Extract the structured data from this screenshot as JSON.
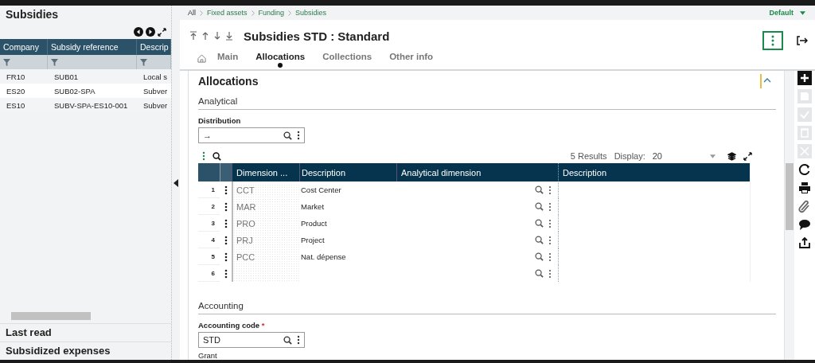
{
  "top_bar": {
    "breadcrumb": [
      "All",
      "Fixed assets",
      "Funding",
      "Subsidies"
    ],
    "profile": "Default"
  },
  "left_panel": {
    "title": "Subsidies",
    "table": {
      "columns": [
        "Company",
        "Subsidy reference",
        "Descrip"
      ],
      "rows": [
        [
          "FR10",
          "SUB01",
          "Local s"
        ],
        [
          "ES20",
          "SUB02-SPA",
          "Subver"
        ],
        [
          "ES10",
          "SUBV-SPA-ES10-001",
          "Subver"
        ]
      ]
    },
    "sections": [
      "Last read",
      "Subsidized expenses"
    ]
  },
  "record": {
    "title": "Subsidies STD : Standard"
  },
  "tabs": [
    {
      "label": "Main",
      "selected": false
    },
    {
      "label": "Allocations",
      "selected": true
    },
    {
      "label": "Collections",
      "selected": false
    },
    {
      "label": "Other info",
      "selected": false
    }
  ],
  "allocations": {
    "title": "Allocations",
    "analytical": {
      "title": "Analytical",
      "distribution": {
        "label": "Distribution",
        "value": "→"
      },
      "grid": {
        "results": "5 Results",
        "display_label": "Display:",
        "display_value": "20",
        "columns": [
          "Dimension ...",
          "Description",
          "Analytical dimension",
          "Description"
        ],
        "rows": [
          {
            "number": "1",
            "dimension": "CCT",
            "description": "Cost Center"
          },
          {
            "number": "2",
            "dimension": "MAR",
            "description": "Market"
          },
          {
            "number": "3",
            "dimension": "PRO",
            "description": "Product"
          },
          {
            "number": "4",
            "dimension": "PRJ",
            "description": "Project"
          },
          {
            "number": "5",
            "dimension": "PCC",
            "description": "Nat. dépense"
          },
          {
            "number": "6"
          }
        ]
      }
    },
    "accounting": {
      "title": "Accounting",
      "code": {
        "label": "Accounting code",
        "required_mark": "*",
        "value": "STD",
        "description": "Grant"
      }
    }
  },
  "actions": [
    {
      "kind": "add",
      "disabled": false
    },
    {
      "kind": "save",
      "disabled": true
    },
    {
      "kind": "validate",
      "disabled": true
    },
    {
      "kind": "delete",
      "disabled": true
    },
    {
      "kind": "close",
      "disabled": true
    },
    {
      "kind": "refresh",
      "disabled": false
    },
    {
      "kind": "print",
      "disabled": false
    },
    {
      "kind": "attach",
      "disabled": false
    },
    {
      "kind": "comment",
      "disabled": false
    },
    {
      "kind": "export",
      "disabled": false
    }
  ]
}
